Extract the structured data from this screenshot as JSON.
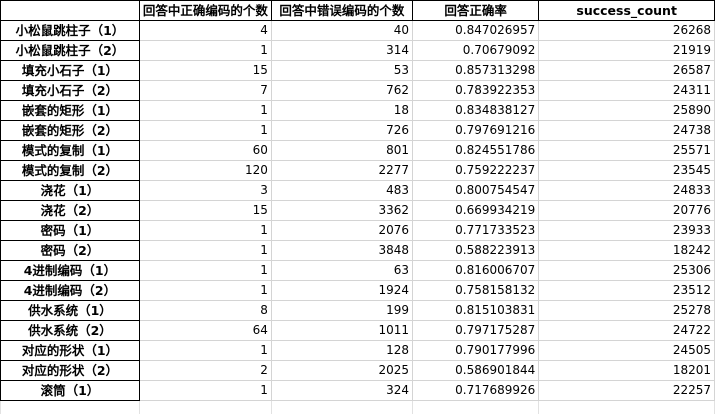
{
  "sheet": {
    "headers": [
      "",
      "回答中正确编码的个数",
      "回答中错误编码的个数",
      "回答正确率",
      "success_count"
    ],
    "rows": [
      {
        "name": "小松鼠跳柱子（1）",
        "correct": "4",
        "wrong": "40",
        "rate": "0.847026957",
        "success": "26268"
      },
      {
        "name": "小松鼠跳柱子（2）",
        "correct": "1",
        "wrong": "314",
        "rate": "0.70679092",
        "success": "21919"
      },
      {
        "name": "填充小石子（1）",
        "correct": "15",
        "wrong": "53",
        "rate": "0.857313298",
        "success": "26587"
      },
      {
        "name": "填充小石子（2）",
        "correct": "7",
        "wrong": "762",
        "rate": "0.783922353",
        "success": "24311"
      },
      {
        "name": "嵌套的矩形（1）",
        "correct": "1",
        "wrong": "18",
        "rate": "0.834838127",
        "success": "25890"
      },
      {
        "name": "嵌套的矩形（2）",
        "correct": "1",
        "wrong": "726",
        "rate": "0.797691216",
        "success": "24738"
      },
      {
        "name": "模式的复制（1）",
        "correct": "60",
        "wrong": "801",
        "rate": "0.824551786",
        "success": "25571"
      },
      {
        "name": "模式的复制（2）",
        "correct": "120",
        "wrong": "2277",
        "rate": "0.759222237",
        "success": "23545"
      },
      {
        "name": "浇花（1）",
        "correct": "3",
        "wrong": "483",
        "rate": "0.800754547",
        "success": "24833"
      },
      {
        "name": "浇花（2）",
        "correct": "15",
        "wrong": "3362",
        "rate": "0.669934219",
        "success": "20776"
      },
      {
        "name": "密码（1）",
        "correct": "1",
        "wrong": "2076",
        "rate": "0.771733523",
        "success": "23933"
      },
      {
        "name": "密码（2）",
        "correct": "1",
        "wrong": "3848",
        "rate": "0.588223913",
        "success": "18242"
      },
      {
        "name": "4进制编码（1）",
        "correct": "1",
        "wrong": "63",
        "rate": "0.816006707",
        "success": "25306"
      },
      {
        "name": "4进制编码（2）",
        "correct": "1",
        "wrong": "1924",
        "rate": "0.758158132",
        "success": "23512"
      },
      {
        "name": "供水系统（1）",
        "correct": "8",
        "wrong": "199",
        "rate": "0.815103831",
        "success": "25278"
      },
      {
        "name": "供水系统（2）",
        "correct": "64",
        "wrong": "1011",
        "rate": "0.797175287",
        "success": "24722"
      },
      {
        "name": "对应的形状（1）",
        "correct": "1",
        "wrong": "128",
        "rate": "0.790177996",
        "success": "24505"
      },
      {
        "name": "对应的形状（2）",
        "correct": "2",
        "wrong": "2025",
        "rate": "0.586901844",
        "success": "18201"
      },
      {
        "name": "滚筒（1）",
        "correct": "1",
        "wrong": "324",
        "rate": "0.717689926",
        "success": "22257"
      }
    ]
  }
}
